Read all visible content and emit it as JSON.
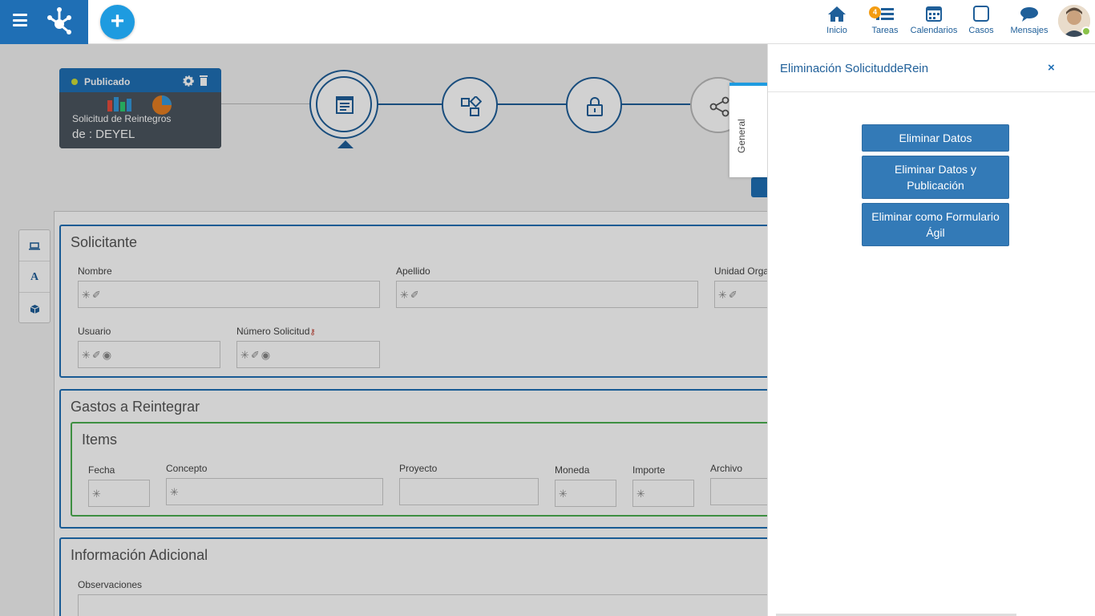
{
  "nav": {
    "items": [
      {
        "label": "Inicio",
        "icon": "home-icon"
      },
      {
        "label": "Tareas",
        "icon": "tasks-icon",
        "badge": "4"
      },
      {
        "label": "Calendarios",
        "icon": "calendar-icon"
      },
      {
        "label": "Casos",
        "icon": "cases-icon"
      },
      {
        "label": "Mensajes",
        "icon": "messages-icon"
      }
    ]
  },
  "form_card": {
    "status": "Publicado",
    "title": "Solicitud de Reintegros",
    "subtitle": "de : DEYEL"
  },
  "general_tab": "General",
  "sections": {
    "solicitante": {
      "title": "Solicitante",
      "nombre": "Nombre",
      "apellido": "Apellido",
      "unidad": "Unidad Orga",
      "usuario": "Usuario",
      "numero": "Número Solicitud"
    },
    "gastos": {
      "title": "Gastos a Reintegrar",
      "items_title": "Items",
      "fecha": "Fecha",
      "concepto": "Concepto",
      "proyecto": "Proyecto",
      "moneda": "Moneda",
      "importe": "Importe",
      "archivo": "Archivo"
    },
    "info": {
      "title": "Información Adicional",
      "observaciones": "Observaciones"
    }
  },
  "panel": {
    "title": "Eliminación SolicituddeRein",
    "close": "×",
    "buttons": [
      "Eliminar Datos",
      "Eliminar Datos y Publicación",
      "Eliminar como Formulario Ágil"
    ]
  },
  "colors": {
    "primary": "#1f6fb5",
    "accent": "#1e9be0",
    "button": "#337ab7"
  }
}
